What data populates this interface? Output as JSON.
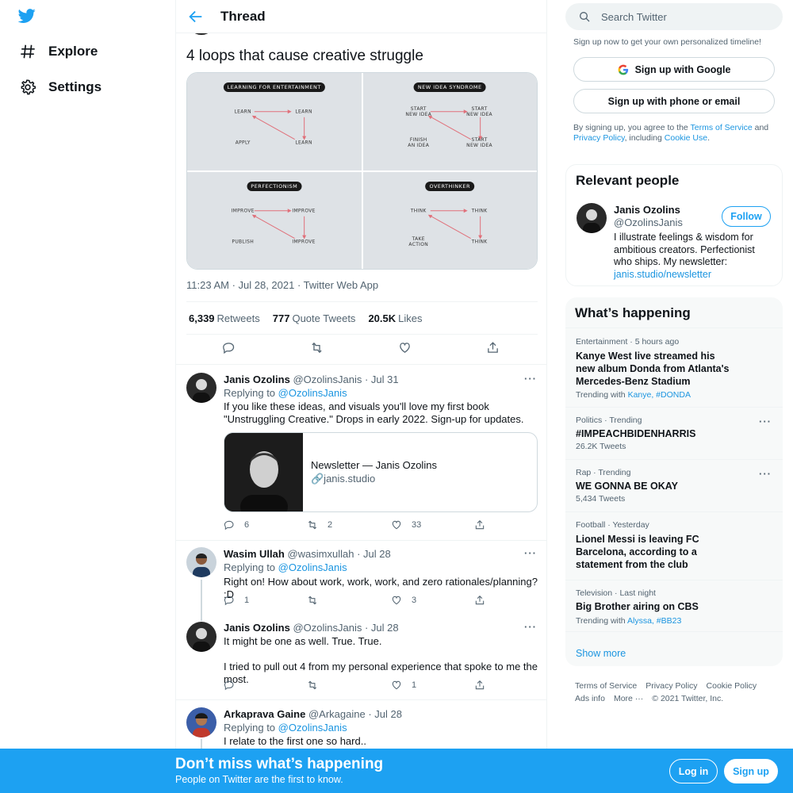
{
  "nav": {
    "items": [
      {
        "label": "Explore",
        "icon": "hash-icon"
      },
      {
        "label": "Settings",
        "icon": "gear-icon"
      }
    ]
  },
  "thread": {
    "title": "Thread",
    "text": "4 loops that cause creative struggle",
    "panels": [
      {
        "title": "LEARNING FOR ENTERTAINMENT",
        "a": "LEARN",
        "b": "LEARN",
        "c": "APPLY",
        "d": "LEARN"
      },
      {
        "title": "NEW IDEA SYNDROME",
        "a": "START\nNEW IDEA",
        "b": "START\nNEW IDEA",
        "c": "FINISH\nAN IDEA",
        "d": "START\nNEW IDEA"
      },
      {
        "title": "PERFECTIONISM",
        "a": "IMPROVE",
        "b": "IMPROVE",
        "c": "PUBLISH",
        "d": "IMPROVE"
      },
      {
        "title": "OVERTHINKER",
        "a": "THINK",
        "b": "THINK",
        "c": "TAKE\nACTION",
        "d": "THINK"
      }
    ],
    "timestamp": "11:23 AM · Jul 28, 2021 · Twitter Web App",
    "stats": {
      "retweets_count": "6,339",
      "retweets_label": "Retweets",
      "quotes_count": "777",
      "quotes_label": "Quote Tweets",
      "likes_count": "20.5K",
      "likes_label": "Likes"
    }
  },
  "replies": [
    {
      "name": "Janis Ozolins",
      "handle": "@OzolinsJanis",
      "date": "· Jul 31",
      "replying_label": "Replying to",
      "replying_to": "@OzolinsJanis",
      "text": "If you like these ideas, and visuals you'll love my first book \"Unstruggling Creative.\" Drops in early 2022. Sign-up for updates.",
      "card_title": "Newsletter — Janis Ozolins",
      "card_domain": "🔗janis.studio",
      "replies": "6",
      "retweets": "2",
      "likes": "33"
    },
    {
      "name": "Wasim Ullah",
      "handle": "@wasimxullah",
      "date": "· Jul 28",
      "replying_label": "Replying to",
      "replying_to": "@OzolinsJanis",
      "text": "Right on! How about work, work, work, and zero rationales/planning? :D",
      "replies": "1",
      "retweets": "",
      "likes": "3"
    },
    {
      "name": "Janis Ozolins",
      "handle": "@OzolinsJanis",
      "date": "· Jul 28",
      "text1": "It might be one as well. True. True.",
      "text2": "I tried to pull out 4 from my personal experience that spoke to me the most.",
      "replies": "",
      "retweets": "",
      "likes": "1"
    },
    {
      "name": "Arkaprava Gaine",
      "handle": "@Arkagaine",
      "date": "· Jul 28",
      "replying_label": "Replying to",
      "replying_to": "@OzolinsJanis",
      "text": "I relate to the first one so hard.."
    }
  ],
  "sidebar": {
    "search_placeholder": "Search Twitter",
    "signup_hint": "Sign up now to get your own personalized timeline!",
    "google_label": "Sign up with Google",
    "phone_label": "Sign up with phone or email",
    "legal_1": "By signing up, you agree to the ",
    "legal_tos": "Terms of Service",
    "legal_2": " and ",
    "legal_privacy": "Privacy Policy",
    "legal_3": ", including ",
    "legal_cookie": "Cookie Use",
    "legal_4": ".",
    "relevant": {
      "title": "Relevant people",
      "name": "Janis Ozolins",
      "handle": "@OzolinsJanis",
      "follow_label": "Follow",
      "bio": "I illustrate feelings & wisdom for ambitious creators. Perfectionist who ships. My newsletter:",
      "bio_link": "janis.studio/newsletter"
    },
    "happening": {
      "title": "What’s happening",
      "trends": [
        {
          "meta": "Entertainment · 5 hours ago",
          "name": "Kanye West live streamed his new album Donda from Atlanta's Mercedes-Benz Stadium",
          "sub": "Trending with",
          "tags": "Kanye, #DONDA"
        },
        {
          "meta": "Politics · Trending",
          "name": "#IMPEACHBIDENHARRIS",
          "sub": "26.2K Tweets",
          "tags": ""
        },
        {
          "meta": "Rap · Trending",
          "name": "WE GONNA BE OKAY",
          "sub": "5,434 Tweets",
          "tags": ""
        },
        {
          "meta": "Football · Yesterday",
          "name": "Lionel Messi is leaving FC Barcelona, according to a statement from the club",
          "sub": "",
          "tags": ""
        },
        {
          "meta": "Television · Last night",
          "name": "Big Brother airing on CBS",
          "sub": "Trending with",
          "tags": "Alyssa, #BB23"
        }
      ],
      "show_more": "Show more"
    },
    "footer": {
      "terms": "Terms of Service",
      "privacy": "Privacy Policy",
      "cookie": "Cookie Policy",
      "ads": "Ads info",
      "more": "More ···",
      "copyright": "© 2021 Twitter, Inc."
    }
  },
  "banner": {
    "title": "Don’t miss what’s happening",
    "subtitle": "People on Twitter are the first to know.",
    "login_label": "Log in",
    "signup_label": "Sign up"
  },
  "colors": {
    "brand": "#1da1f2",
    "link": "#1b95e0",
    "arrow": "#e0707a"
  }
}
